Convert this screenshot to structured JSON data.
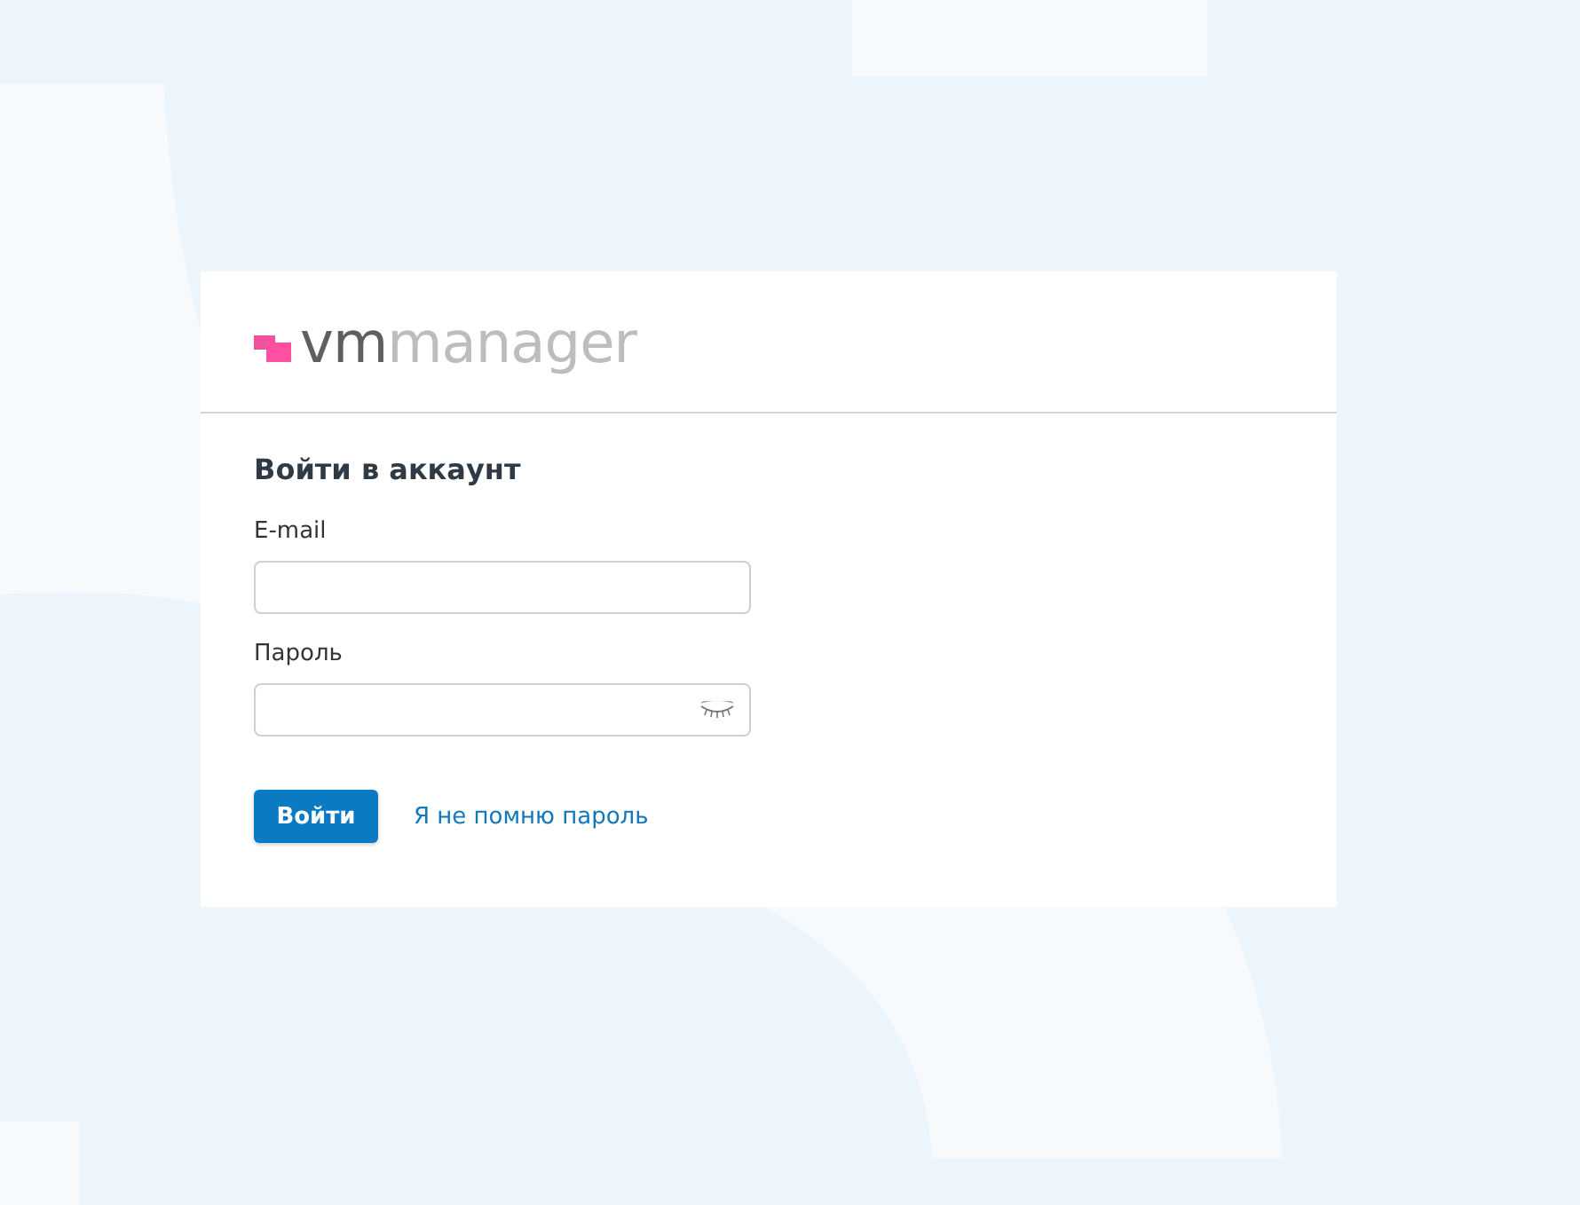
{
  "logo": {
    "part_1": "vm",
    "part_2": "manager"
  },
  "form": {
    "title": "Войти в аккаунт",
    "fields": [
      {
        "label": "E-mail",
        "kind": "text"
      },
      {
        "label": "Пароль",
        "kind": "password"
      }
    ],
    "submit": "Войти",
    "forgot_link": "Я не помню пароль"
  }
}
